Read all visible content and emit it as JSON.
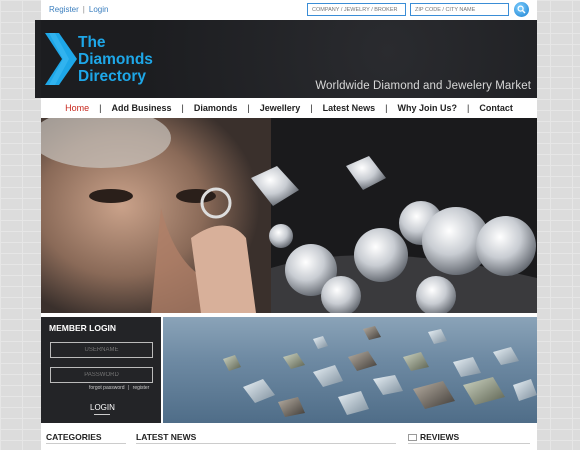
{
  "topbar": {
    "register_label": "Register",
    "separator": "|",
    "login_label": "Login",
    "search_company_placeholder": "COMPANY / JEWELRY / BROKER",
    "search_zip_placeholder": "ZIP CODE / CITY NAME"
  },
  "header": {
    "logo_line1": "The",
    "logo_line2": "Diamonds",
    "logo_line3": "Directory",
    "tagline": "Worldwide Diamond and Jewelery Market",
    "brand_color": "#1ea7e8"
  },
  "nav": {
    "items": [
      "Home",
      "Add Business",
      "Diamonds",
      "Jewellery",
      "Latest News",
      "Why Join Us?",
      "Contact"
    ],
    "separator": "|",
    "active_color": "#c8281e"
  },
  "login": {
    "title": "MEMBER LOGIN",
    "username_placeholder": "USERNAME",
    "password_placeholder": "PASSWORD",
    "forgot_label": "forgot password",
    "link_sep": "|",
    "register_label": "register",
    "button_label": "LOGIN"
  },
  "sections": {
    "categories": "CATEGORIES",
    "latest_news": "LATEST NEWS",
    "reviews": "REVIEWS"
  }
}
